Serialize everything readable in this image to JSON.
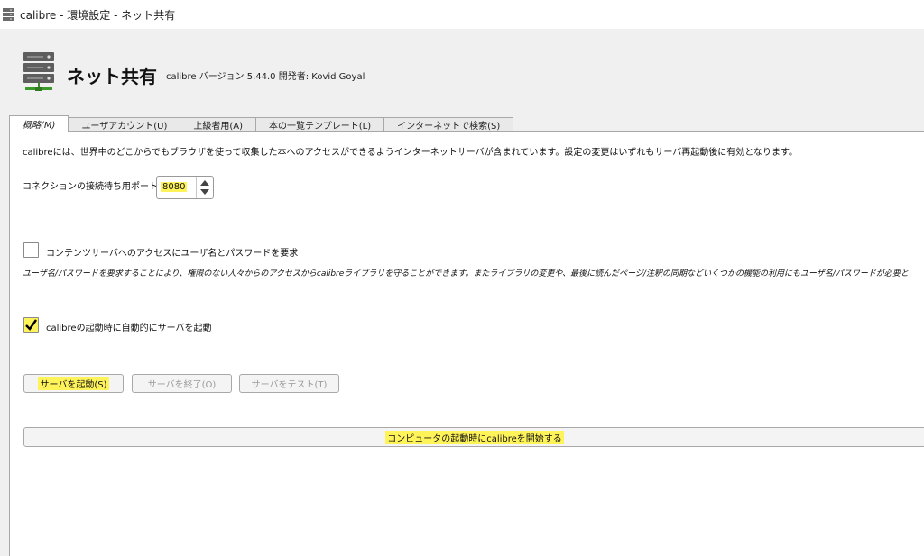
{
  "window": {
    "title": "calibre - 環境設定 - ネット共有"
  },
  "header": {
    "heading": "ネット共有",
    "version": "calibre バージョン 5.44.0 開発者: Kovid Goyal"
  },
  "tabs": [
    {
      "label": "概略(M)",
      "active": true
    },
    {
      "label": "ユーザアカウント(U)",
      "active": false
    },
    {
      "label": "上級者用(A)",
      "active": false
    },
    {
      "label": "本の一覧テンプレート(L)",
      "active": false
    },
    {
      "label": "インターネットで検索(S)",
      "active": false
    }
  ],
  "main": {
    "description": "calibreには、世界中のどこからでもブラウザを使って収集した本へのアクセスができるようインターネットサーバが含まれています。設定の変更はいずれもサーバ再起動後に有効となります。",
    "port_label": "コネクションの接続待ち用ポート:",
    "port_value": "8080",
    "require_auth_label": "コンテンツサーバへのアクセスにユーザ名とパスワードを要求",
    "require_auth_checked": false,
    "auth_note": "ユーザ名/パスワードを要求することにより、権限のない人々からのアクセスからcalibreライブラリを守ることができます。またライブラリの変更や、最後に読んだページ/注釈の同期などいくつかの機能の利用にもユーザ名/パスワードが必要と",
    "autostart_label": "calibreの起動時に自動的にサーバを起動",
    "autostart_checked": true,
    "start_button": "サーバを起動(S)",
    "stop_button": "サーバを終了(O)",
    "test_button": "サーバをテスト(T)",
    "boot_button": "コンピュータの起動時にcalibreを開始する"
  },
  "colors": {
    "highlight": "#fff35a",
    "panel": "#ffffff",
    "background": "#f0f0f0"
  }
}
